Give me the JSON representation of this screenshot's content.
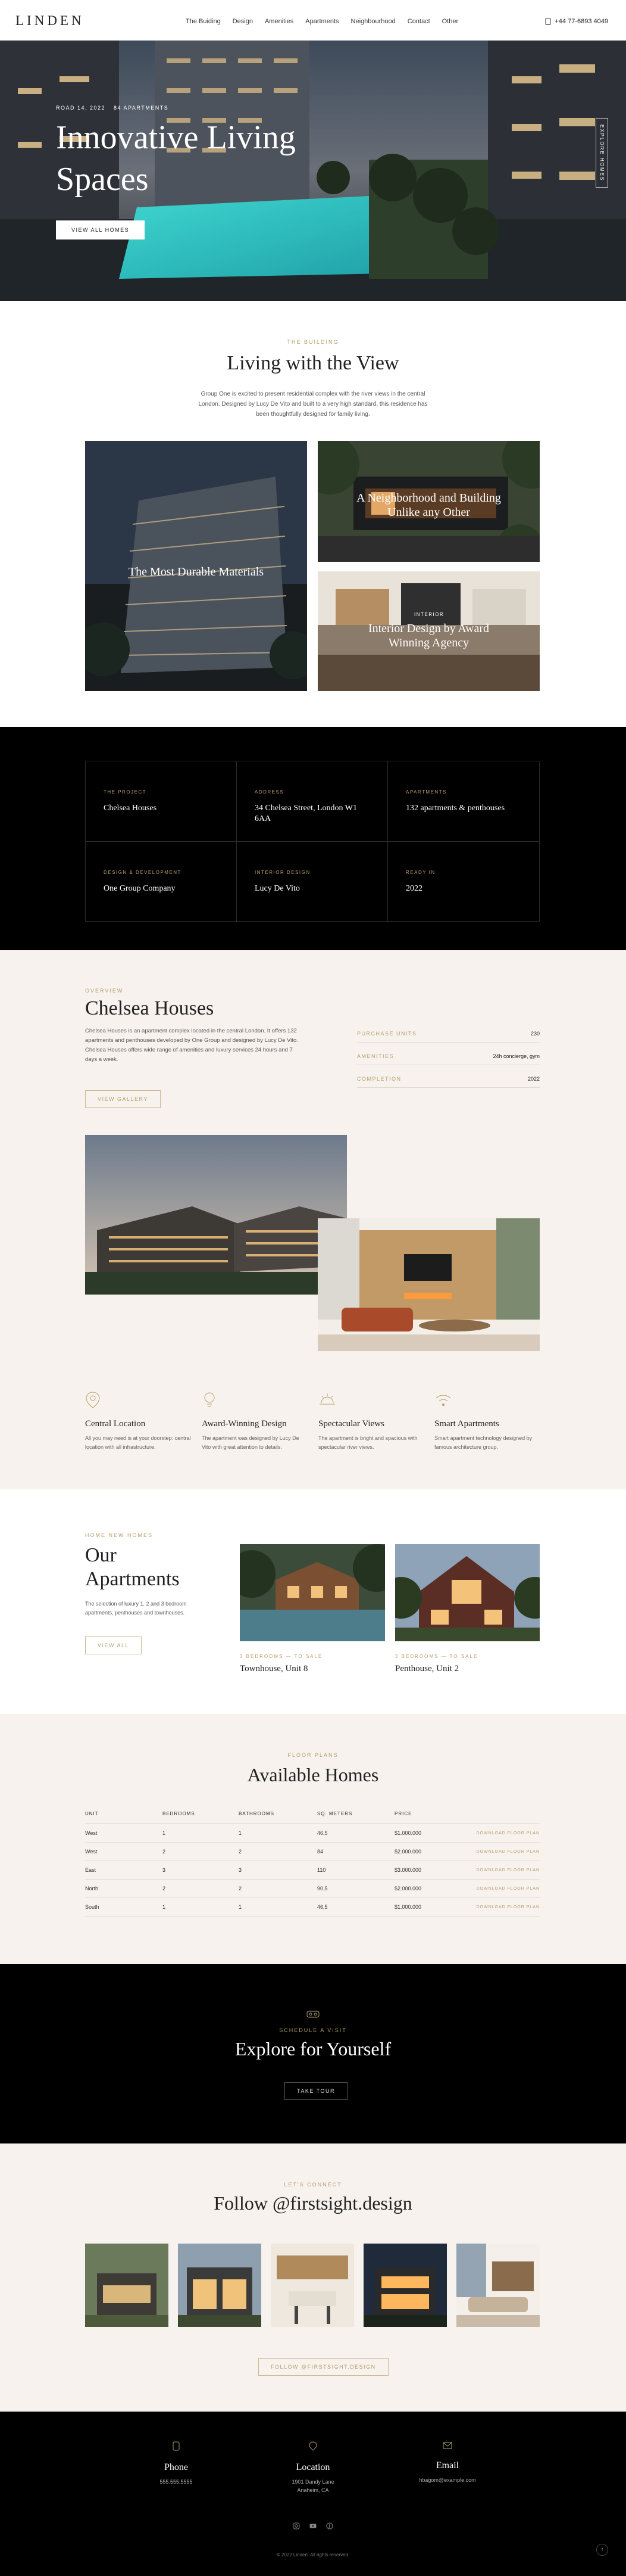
{
  "header": {
    "logo": "LINDEN",
    "nav": [
      "The Buiding",
      "Design",
      "Amenities",
      "Apartments",
      "Neighbourhood",
      "Contact",
      "Other"
    ],
    "phone": "+44 77-6893 4049"
  },
  "hero": {
    "meta_date": "ROAD 14, 2022",
    "meta_units": "84 APARTMENTS",
    "title_line1": "Innovative Living",
    "title_line2": "Spaces",
    "button": "VIEW ALL HOMES",
    "vertical_label": "EXPLORE HOMES"
  },
  "living": {
    "eyebrow": "THE BUILDING",
    "title": "Living with the View",
    "desc": "Group One is excited to present residential complex with the river views in the central London. Designed by Lucy De Vito and built to a very high standard, this residence has been thoughtfully designed for family living.",
    "card1": "The Most Durable Materials",
    "card2_line1": "A Neighborhood and Building",
    "card2_line2": "Unlike any Other",
    "card3_tag": "INTERIOR",
    "card3_line1": "Interior Design by Award",
    "card3_line2": "Winning Agency"
  },
  "project": {
    "cells": [
      {
        "k": "THE PROJECT",
        "v": "Chelsea Houses"
      },
      {
        "k": "ADDRESS",
        "v": "34 Chelsea Street, London W1 6AA"
      },
      {
        "k": "APARTMENTS",
        "v": "132 apartments & penthouses"
      },
      {
        "k": "DESIGN & DEVELOPMENT",
        "v": "One Group Company"
      },
      {
        "k": "INTERIOR DESIGN",
        "v": "Lucy De Vito"
      },
      {
        "k": "READY IN",
        "v": "2022"
      }
    ]
  },
  "chelsea": {
    "eyebrow": "OVERVIEW",
    "title": "Chelsea Houses",
    "desc": "Chelsea Houses is an apartment complex located in the central London. It offers 132 apartments and penthouses developed by One Group and designed by Lucy De Vito. Chelsea Houses offers wide range of amenities and luxury services 24 hours and 7 days a week.",
    "button": "VIEW GALLERY",
    "stats": [
      {
        "k": "PURCHASE UNITS",
        "v": "230"
      },
      {
        "k": "AMENITIES",
        "v": "24h concierge, gym"
      },
      {
        "k": "COMPLETION",
        "v": "2022"
      }
    ],
    "features": [
      {
        "icon": "location-icon",
        "title": "Central Location",
        "desc": "All you may need is at your doorstep: central location with all infrastructure."
      },
      {
        "icon": "lightbulb-icon",
        "title": "Award-Winning Design",
        "desc": "The apartment was designed by Lucy De Vito with great attention to details."
      },
      {
        "icon": "sun-icon",
        "title": "Spectacular Views",
        "desc": "The apartment is bright and spacious with spectacular river views."
      },
      {
        "icon": "wifi-icon",
        "title": "Smart Apartments",
        "desc": "Smart apartment technology designed by famous architecture group."
      }
    ]
  },
  "apartments": {
    "eyebrow": "HOME NEW HOMES",
    "title_line1": "Our",
    "title_line2": "Apartments",
    "desc": "The selection of luxury 1, 2 and 3 bedroom apartments, penthouses and townhouses.",
    "button": "VIEW ALL",
    "items": [
      {
        "meta": "3 BEDROOMS — TO SALE",
        "name": "Townhouse, Unit 8"
      },
      {
        "meta": "3 BEDROOMS — TO SALE",
        "name": "Penthouse, Unit 2"
      }
    ]
  },
  "homes": {
    "eyebrow": "FLOOR PLANS",
    "title": "Available Homes",
    "columns": [
      "UNIT",
      "BEDROOMS",
      "BATHROOMS",
      "SQ. METERS",
      "PRICE",
      ""
    ],
    "download": "DOWNLOAD FLOOR PLAN",
    "rows": [
      [
        "West",
        "1",
        "1",
        "46,5",
        "$1.000.000"
      ],
      [
        "West",
        "2",
        "2",
        "84",
        "$2.000.000"
      ],
      [
        "East",
        "3",
        "3",
        "110",
        "$3.000.000"
      ],
      [
        "North",
        "2",
        "2",
        "90,5",
        "$2.000.000"
      ],
      [
        "South",
        "1",
        "1",
        "46,5",
        "$1.000.000"
      ]
    ]
  },
  "explore": {
    "eyebrow": "SCHEDULE A VISIT",
    "title": "Explore for Yourself",
    "button": "TAKE TOUR"
  },
  "follow": {
    "eyebrow": "LET'S CONNECT",
    "title": "Follow @firstsight.design",
    "button": "FOLLOW @FIRSTSIGHT.DESIGN"
  },
  "footer": {
    "cols": [
      {
        "icon": "phone-icon",
        "title": "Phone",
        "sub": "555.555.5555"
      },
      {
        "icon": "location-icon",
        "title": "Location",
        "sub": "1901 Dandy Lane\nAnaheim, CA"
      },
      {
        "icon": "mail-icon",
        "title": "Email",
        "sub": "hbagom@example.com"
      }
    ],
    "copyright": "© 2022 Linden. All rights reserved."
  }
}
